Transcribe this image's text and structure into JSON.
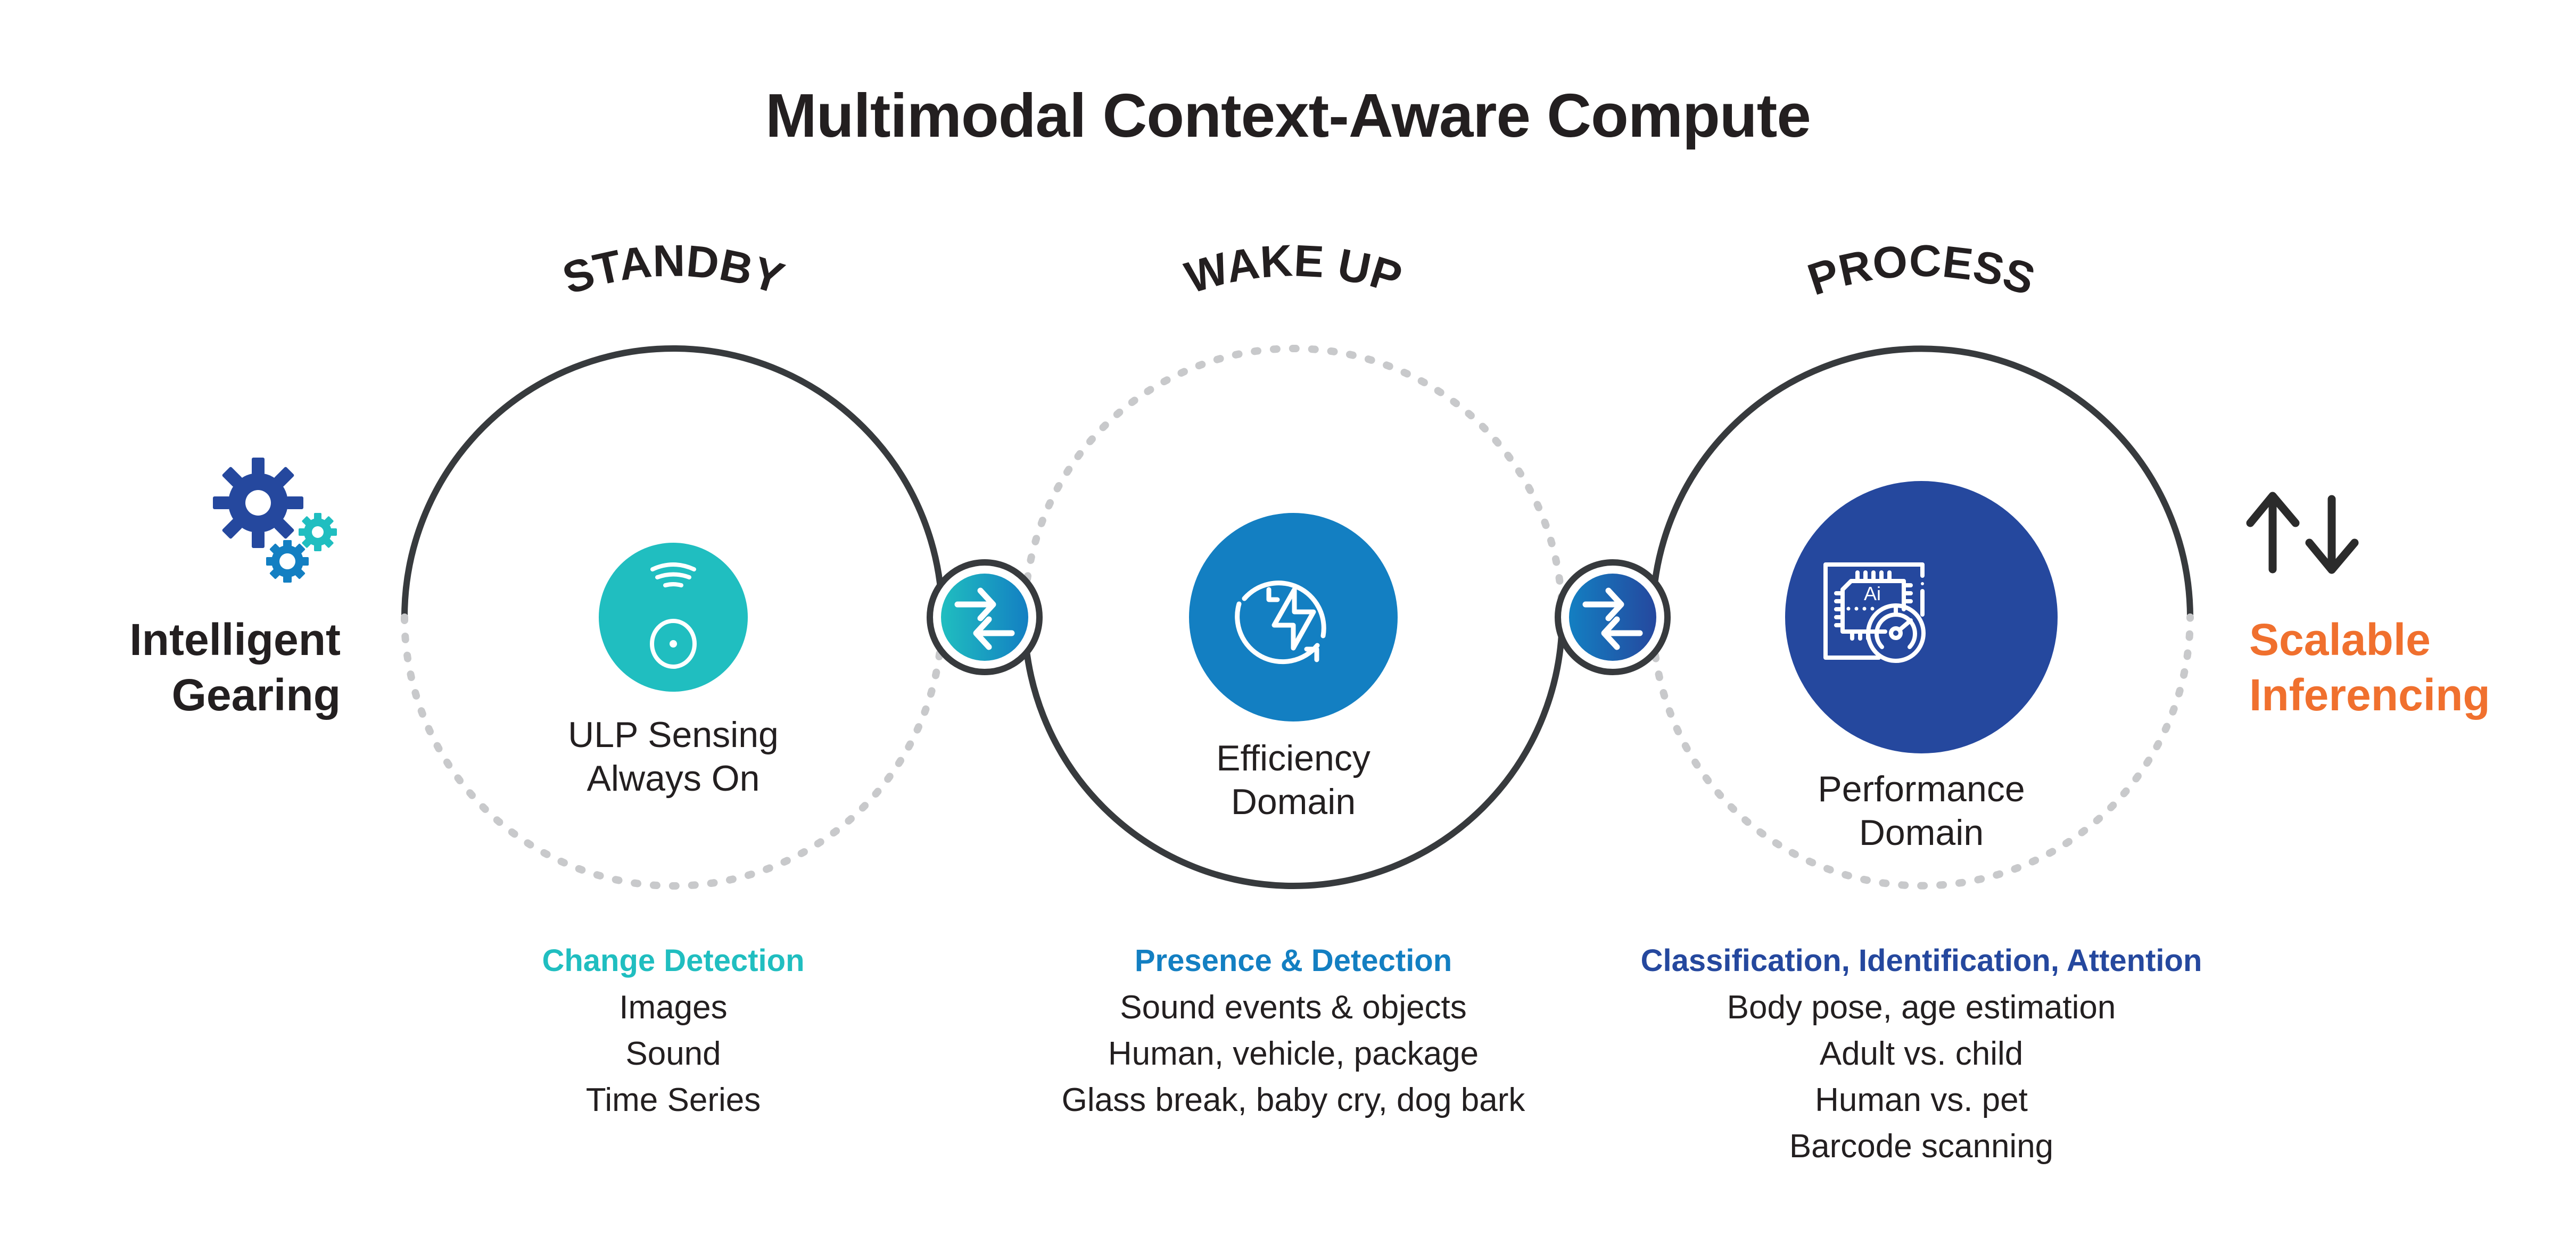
{
  "title": "Multimodal Context-Aware Compute",
  "colors": {
    "text": "#231f20",
    "ring": "#373a3d",
    "dots": "#c8c9cb",
    "teal": "#20bec0",
    "blue": "#137fc2",
    "navy": "#25489e",
    "orange": "#f0702e"
  },
  "left": {
    "icon": "gears-icon",
    "label_line1": "Intelligent",
    "label_line2": "Gearing"
  },
  "right": {
    "icon": "up-down-arrows-icon",
    "label_line1": "Scalable",
    "label_line2": "Inferencing"
  },
  "stages": [
    {
      "arc_label": "STANDBY",
      "icon": "wireless-sensor-icon",
      "center_line1": "ULP Sensing",
      "center_line2": "Always On",
      "detail_heading": "Change Detection",
      "detail_items": [
        "Images",
        "Sound",
        "Time Series"
      ]
    },
    {
      "arc_label": "WAKE UP",
      "icon": "lightning-refresh-icon",
      "center_line1": "Efficiency",
      "center_line2": "Domain",
      "detail_heading": "Presence & Detection",
      "detail_items": [
        "Sound events & objects",
        "Human, vehicle, package",
        "Glass break, baby cry, dog bark"
      ]
    },
    {
      "arc_label": "PROCESS",
      "icon": "ai-chip-gauge-icon",
      "center_line1": "Performance",
      "center_line2": "Domain",
      "detail_heading": "Classification, Identification, Attention",
      "detail_items": [
        "Body pose, age estimation",
        "Adult vs. child",
        "Human vs. pet",
        "Barcode scanning"
      ]
    }
  ],
  "connectors": [
    {
      "icon": "swap-arrows-icon"
    },
    {
      "icon": "swap-arrows-icon"
    }
  ],
  "chip_icon_text": "Ai"
}
